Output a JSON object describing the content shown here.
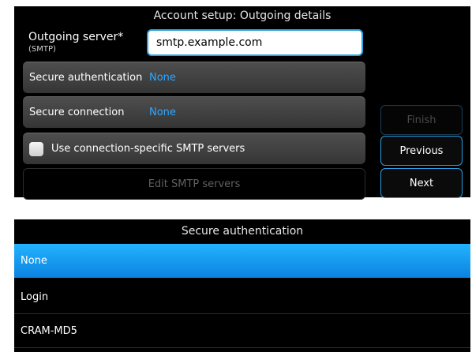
{
  "account_setup": {
    "title": "Account setup: Outgoing details",
    "server": {
      "label": "Outgoing server*",
      "sublabel": "(SMTP)",
      "value": "smtp.example.com"
    },
    "secure_auth": {
      "label": "Secure authentication",
      "value": "None"
    },
    "secure_conn": {
      "label": "Secure connection",
      "value": "None"
    },
    "use_conn_smtp": {
      "label": "Use connection-specific SMTP servers",
      "checked": false
    },
    "edit_smtp_label": "Edit SMTP servers",
    "buttons": {
      "finish": "Finish",
      "previous": "Previous",
      "next": "Next"
    }
  },
  "auth_list": {
    "title": "Secure authentication",
    "options": [
      "None",
      "Login",
      "CRAM-MD5"
    ],
    "selected": "None"
  },
  "colors": {
    "accent": "#2fa7ff",
    "selected_bg": "#1a9ef0",
    "background": "#000000"
  }
}
